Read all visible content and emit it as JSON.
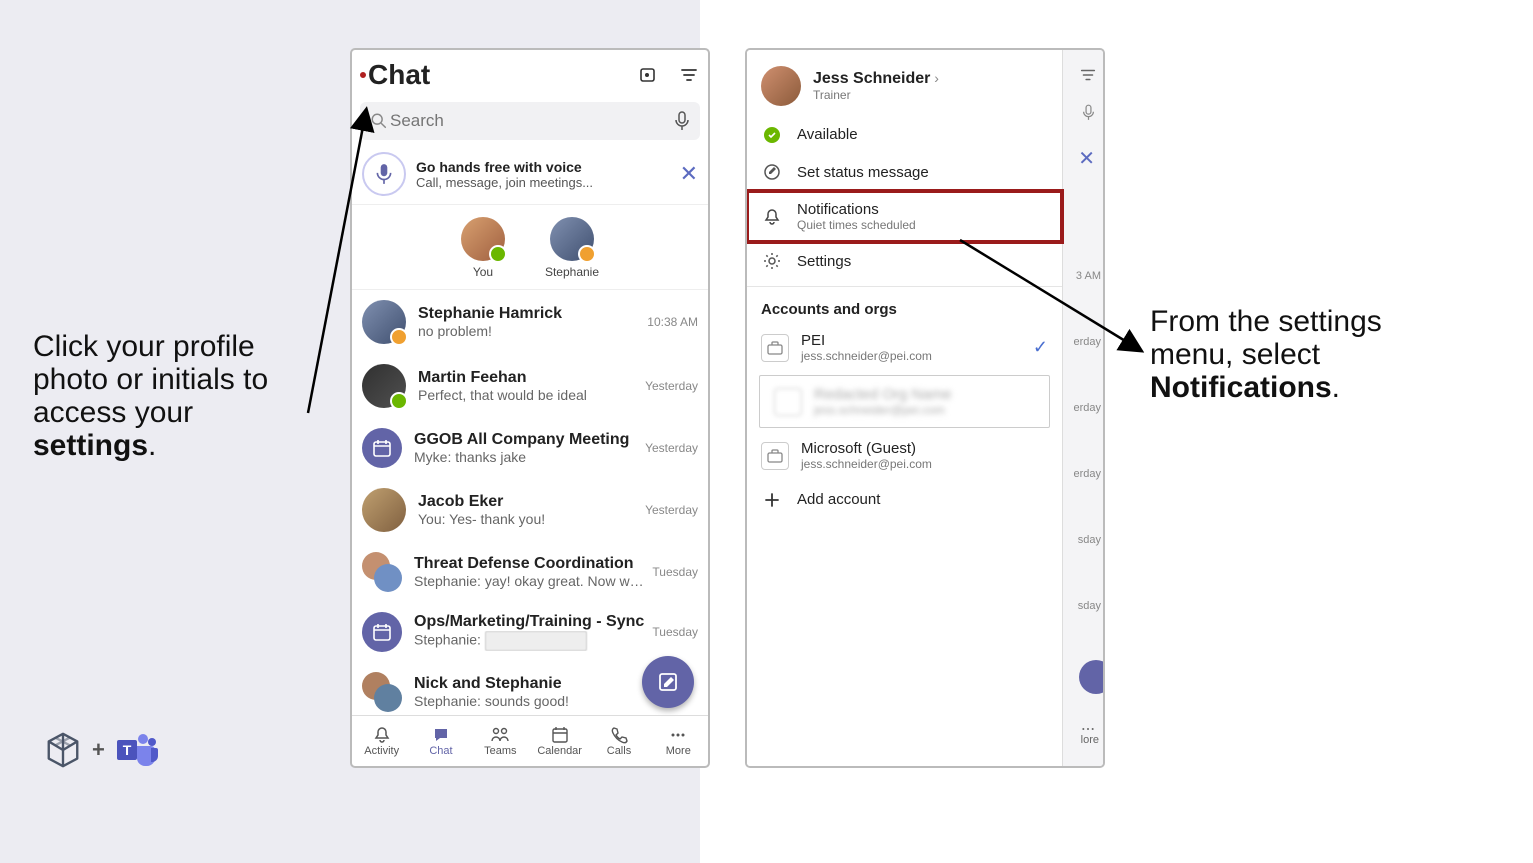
{
  "captions": {
    "left_pre": "Click your profile photo or initials to access your ",
    "left_bold": "settings",
    "left_post": ".",
    "right_pre": "From the settings menu, select ",
    "right_bold": "Notifications",
    "right_post": "."
  },
  "phone1": {
    "title": "Chat",
    "search_placeholder": "Search",
    "banner": {
      "title": "Go hands free with voice",
      "subtitle": "Call, message, join meetings..."
    },
    "pinned": [
      {
        "name": "You",
        "presence": "green"
      },
      {
        "name": "Stephanie",
        "presence": "away"
      }
    ],
    "conversations": [
      {
        "name": "Stephanie Hamrick",
        "msg": "no problem!",
        "time": "10:38 AM",
        "type": "person",
        "presence": "away"
      },
      {
        "name": "Martin Feehan",
        "msg": "Perfect, that would be ideal",
        "time": "Yesterday",
        "type": "person",
        "presence": "green"
      },
      {
        "name": "GGOB All Company Meeting",
        "msg": "Myke: thanks jake",
        "time": "Yesterday",
        "type": "meeting"
      },
      {
        "name": "Jacob Eker",
        "msg": "You: Yes- thank you!",
        "time": "Yesterday",
        "type": "person"
      },
      {
        "name": "Threat Defense Coordination",
        "msg": "Stephanie: yay! okay great. Now we get...",
        "time": "Tuesday",
        "type": "group"
      },
      {
        "name": "Ops/Marketing/Training - Sync",
        "msg_pre": "Stephanie: ",
        "time": "Tuesday",
        "type": "meeting",
        "redacted": true
      },
      {
        "name": "Nick and Stephanie",
        "msg": "Stephanie: sounds good!",
        "time": "",
        "type": "group"
      }
    ],
    "tabs": [
      {
        "label": "Activity"
      },
      {
        "label": "Chat"
      },
      {
        "label": "Teams"
      },
      {
        "label": "Calendar"
      },
      {
        "label": "Calls"
      },
      {
        "label": "More"
      }
    ]
  },
  "phone2": {
    "user": {
      "name": "Jess Schneider",
      "role": "Trainer"
    },
    "status": {
      "label": "Available"
    },
    "set_status": "Set status message",
    "notifications": {
      "title": "Notifications",
      "subtitle": "Quiet times scheduled"
    },
    "settings": "Settings",
    "accounts_title": "Accounts and orgs",
    "orgs": [
      {
        "name": "PEI",
        "email": "jess.schneider@pei.com",
        "selected": true
      },
      {
        "name": "Redacted Org Name",
        "email": "jess.schneider@pei.com",
        "blurred": true
      },
      {
        "name": "Microsoft (Guest)",
        "email": "jess.schneider@pei.com"
      }
    ],
    "add_account": "Add account",
    "bg_times": [
      "",
      "",
      "3 AM",
      "erday",
      "erday",
      "erday",
      "sday",
      "sday"
    ],
    "bg_more": "lore"
  }
}
